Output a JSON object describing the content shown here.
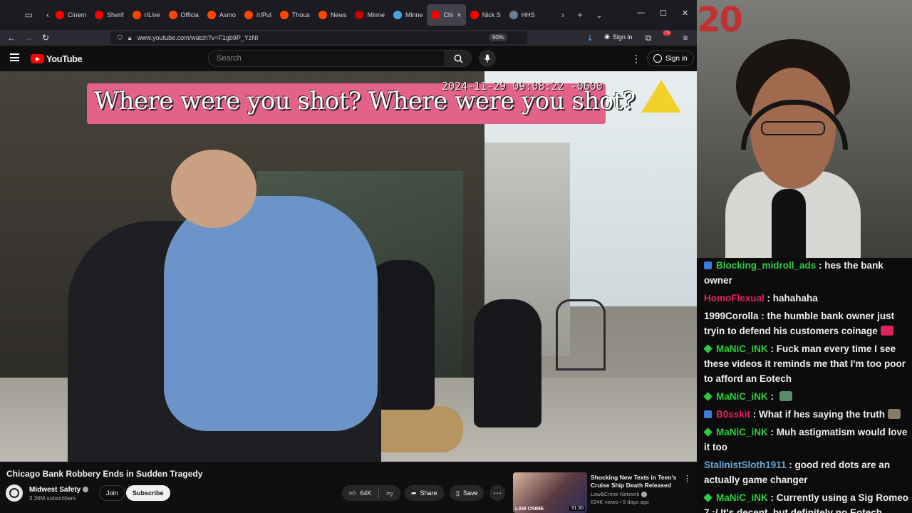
{
  "browser": {
    "tabs": [
      {
        "label": "Cinem",
        "color": "#ff0000"
      },
      {
        "label": "Sherif",
        "color": "#ff0000"
      },
      {
        "label": "r/Live",
        "color": "#ff4500"
      },
      {
        "label": "Officia",
        "color": "#ff4500"
      },
      {
        "label": "Asmo",
        "color": "#ff4500"
      },
      {
        "label": "/r/Pul",
        "color": "#ff4500"
      },
      {
        "label": "Thous",
        "color": "#ff4500"
      },
      {
        "label": "News",
        "color": "#ff4500"
      },
      {
        "label": "Minne",
        "color": "#cc0000"
      },
      {
        "label": "Minne",
        "color": "#4aa3df"
      },
      {
        "label": "Chi",
        "color": "#ff0000"
      },
      {
        "label": "Nick S",
        "color": "#ff0000"
      },
      {
        "label": "HHS",
        "color": "#6b7c93"
      }
    ],
    "url": "www.youtube.com/watch?v=F1gb9P_YzNI",
    "zoom": "90%",
    "signin_label": "Sign in",
    "notification_count": "70"
  },
  "youtube": {
    "logo_text": "YouTube",
    "search_placeholder": "Search",
    "signin_label": "Sign in"
  },
  "video": {
    "caption": "Where were you shot? Where were you shot?",
    "timestamp": "2024-11-29 09:08:22 -0600",
    "close_mark": "x"
  },
  "details": {
    "title": "Chicago Bank Robbery Ends in Sudden Tragedy",
    "channel": "Midwest Safety",
    "subscribers": "3.36M subscribers",
    "join_label": "Join",
    "subscribe_label": "Subscribe",
    "likes": "64K",
    "share_label": "Share",
    "save_label": "Save"
  },
  "recommended": {
    "title": "Shocking New Texts in Teen's Cruise Ship Death Released",
    "channel": "Law&Crime Network",
    "meta": "634K views • 9 days ago",
    "duration": "31:30",
    "thumb_text": "LAW CRIME"
  },
  "webcam": {
    "overlay_text": "20"
  },
  "chat": [
    {
      "badge": "box",
      "user": "Blocking_midroll_ads",
      "user_color": "#2ecc40",
      "text": "hes the bank owner"
    },
    {
      "badge": "",
      "user": "HomoFlexual",
      "user_color": "#e0245e",
      "text": "hahahaha"
    },
    {
      "badge": "",
      "user": "1999Corolla",
      "user_color": "#efefef",
      "text": "the humble bank owner just tryin to defend his customers coinage",
      "emote": "#e0245e"
    },
    {
      "badge": "gem",
      "user": "MaNiC_iNK",
      "user_color": "#2ecc40",
      "text": "Fuck man every time I see these videos it reminds me that I'm too poor to afford an Eotech"
    },
    {
      "badge": "gem",
      "user": "MaNiC_iNK",
      "user_color": "#2ecc40",
      "text": "",
      "emote": "#5b8c6a"
    },
    {
      "badge": "box",
      "user": "B0sskit",
      "user_color": "#e0245e",
      "text": "What if hes saying the truth",
      "emote": "#8a7a6a"
    },
    {
      "badge": "gem",
      "user": "MaNiC_iNK",
      "user_color": "#2ecc40",
      "text": "Muh astigmatism would love it too"
    },
    {
      "badge": "",
      "user": "StalinistSloth1911",
      "user_color": "#6fa8dc",
      "text": "good red dots are an actually game changer"
    },
    {
      "badge": "gem",
      "user": "MaNiC_iNK",
      "user_color": "#2ecc40",
      "text": "Currently using a Sig Romeo 7 :/ It's decent, but definitely no Eotech"
    }
  ]
}
